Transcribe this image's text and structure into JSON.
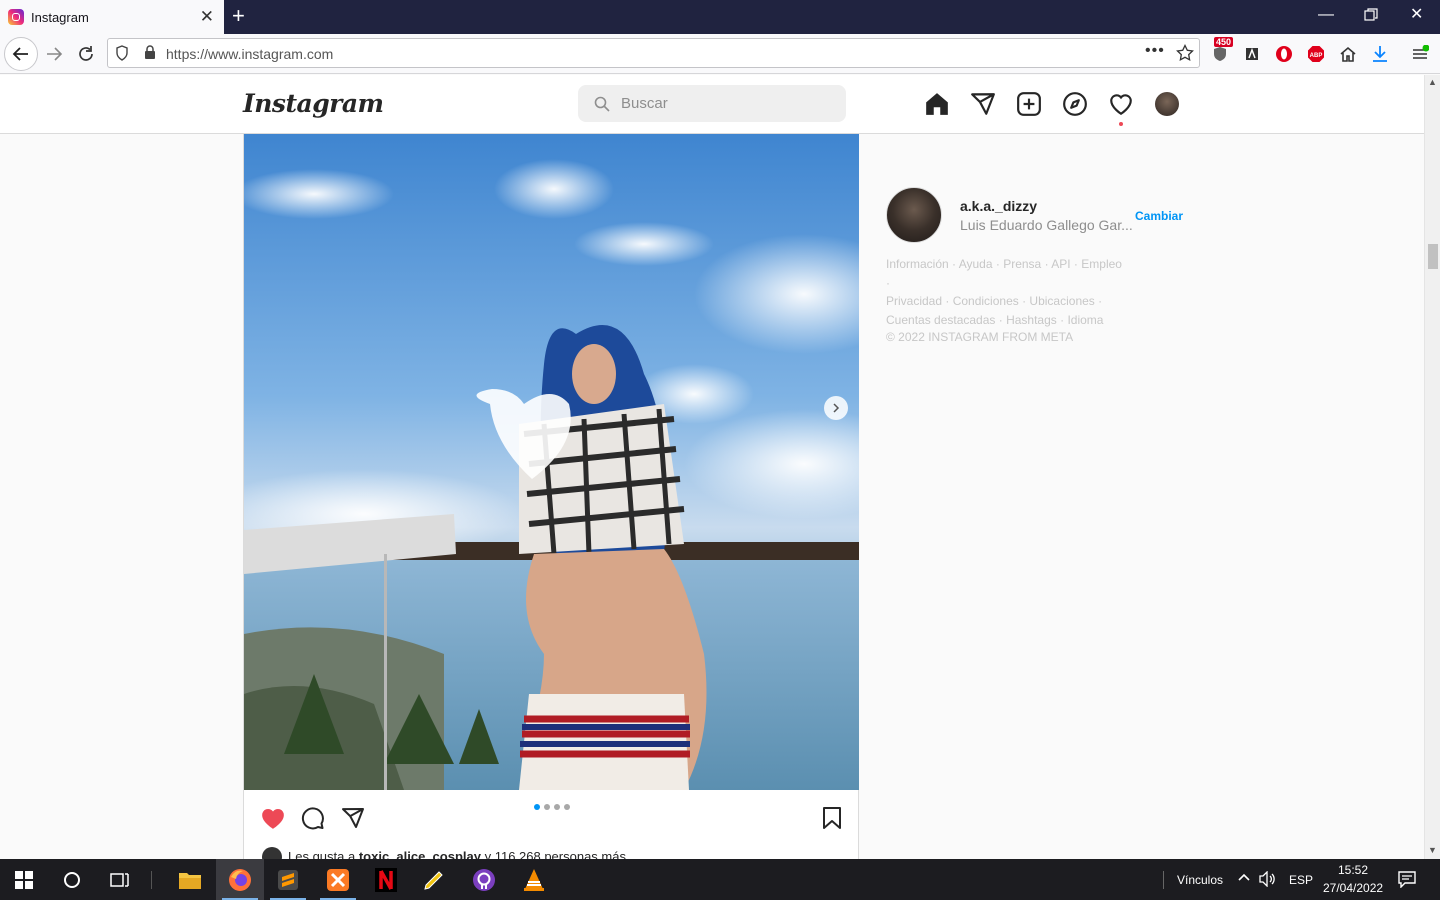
{
  "browser": {
    "tab_title": "Instagram",
    "url": "https://www.instagram.com",
    "badge_count": "450"
  },
  "instagram": {
    "logo": "Instagram",
    "search_placeholder": "Buscar",
    "nav_icons": [
      "home-icon",
      "direct-icon",
      "new-post-icon",
      "explore-icon",
      "activity-icon",
      "profile-avatar"
    ]
  },
  "post": {
    "carousel_total": 4,
    "carousel_active": 1,
    "likes_prefix": "Les gusta a ",
    "likes_user": "toxic_alice_cosplay",
    "likes_suffix": " y 116.268 personas más"
  },
  "sidebar": {
    "username": "a.k.a._dizzy",
    "full_name": "Luis Eduardo Gallego Gar...",
    "switch_label": "Cambiar",
    "footer_links": [
      "Información",
      "Ayuda",
      "Prensa",
      "API",
      "Empleo",
      "Privacidad",
      "Condiciones",
      "Ubicaciones",
      "Cuentas destacadas",
      "Hashtags",
      "Idioma"
    ],
    "copyright": "© 2022 INSTAGRAM FROM META"
  },
  "taskbar": {
    "links_label": "Vínculos",
    "language": "ESP",
    "time": "15:52",
    "date": "27/04/2022"
  },
  "colors": {
    "accent_blue": "#0095f6",
    "like_red": "#ed4956",
    "titlebar": "#202340"
  }
}
